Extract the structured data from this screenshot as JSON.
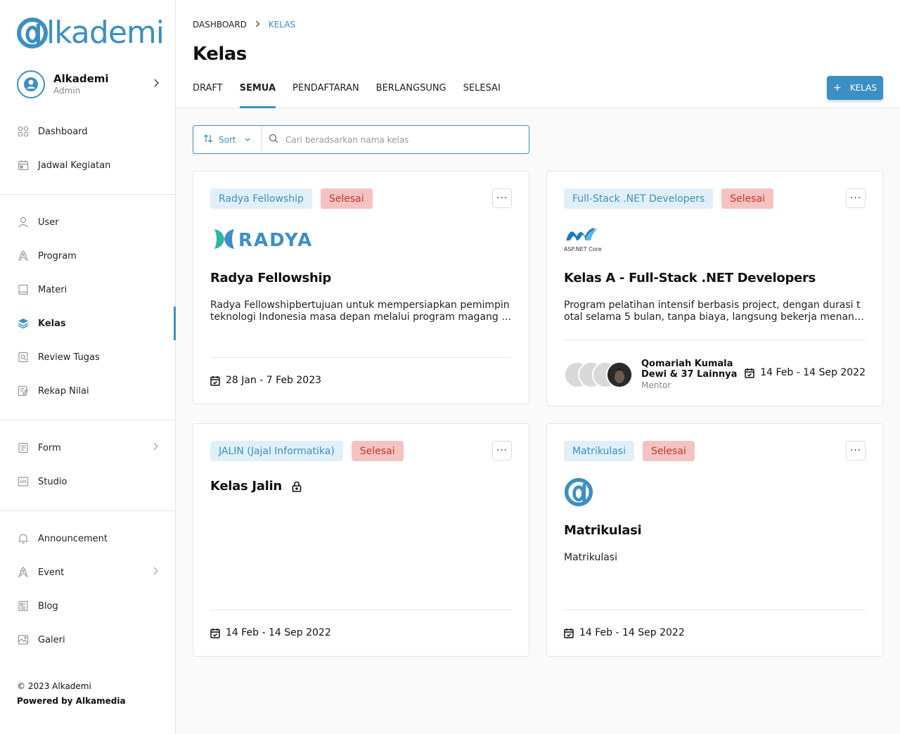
{
  "app": {
    "logo_text": "lkademi"
  },
  "profile": {
    "name": "Alkademi",
    "role": "Admin"
  },
  "nav": {
    "group1": [
      {
        "label": "Dashboard",
        "icon": "grid-icon"
      },
      {
        "label": "Jadwal Kegiatan",
        "icon": "calendar-icon"
      }
    ],
    "group2": [
      {
        "label": "User",
        "icon": "user-icon"
      },
      {
        "label": "Program",
        "icon": "rocket-icon"
      },
      {
        "label": "Materi",
        "icon": "book-icon"
      },
      {
        "label": "Kelas",
        "icon": "layers-icon",
        "active": true
      },
      {
        "label": "Review Tugas",
        "icon": "review-icon"
      },
      {
        "label": "Rekap Nilai",
        "icon": "edit-icon"
      }
    ],
    "group3": [
      {
        "label": "Form",
        "icon": "form-icon",
        "has_chevron": true
      },
      {
        "label": "Studio",
        "icon": "code-icon"
      }
    ],
    "group4": [
      {
        "label": "Announcement",
        "icon": "bell-icon"
      },
      {
        "label": "Event",
        "icon": "rocket-icon",
        "has_chevron": true
      },
      {
        "label": "Blog",
        "icon": "blog-icon"
      },
      {
        "label": "Galeri",
        "icon": "image-icon"
      }
    ]
  },
  "footer": {
    "copyright": "© 2023 Alkademi",
    "powered": "Powered by Alkamedia"
  },
  "breadcrumb": {
    "home": "DASHBOARD",
    "current": "KELAS"
  },
  "page_title": "Kelas",
  "tabs": [
    {
      "label": "DRAFT"
    },
    {
      "label": "SEMUA",
      "active": true
    },
    {
      "label": "PENDAFTARAN"
    },
    {
      "label": "BERLANGSUNG"
    },
    {
      "label": "SELESAI"
    }
  ],
  "add_button": {
    "label": "KELAS"
  },
  "toolbar": {
    "sort_label": "Sort",
    "search_placeholder": "Cari beradsarkan nama kelas"
  },
  "cards": [
    {
      "program": "Radya Fellowship",
      "status": "Selesai",
      "logo": "RADYA",
      "title": "Radya Fellowship",
      "description": "Radya Fellowshipbertujuan untuk mempersiapkan pemimpin teknologi Indonesia masa depan melalui program magang bersama Radya Labs.",
      "date": "28 Jan - 7 Feb 2023"
    },
    {
      "program": "Full-Stack .NET Developers",
      "status": "Selesai",
      "logo": "ASP.NET Core",
      "title": "Kelas A - Full-Stack .NET Developers",
      "description": "Program pelatihan intensif berbasis project, dengan durasi total selama 5 bulan, tanpa biaya, langsung bekerja menangani proyek nyata.",
      "mentor_names": "Qomariah Kumala Dewi & 37 Lainnya",
      "mentor_role": "Mentor",
      "date": "14 Feb - 14 Sep 2022"
    },
    {
      "program": "JALIN (Jajal Informatika)",
      "status": "Selesai",
      "title": "Kelas Jalin",
      "date": "14 Feb - 14 Sep 2022"
    },
    {
      "program": "Matrikulasi",
      "status": "Selesai",
      "title": "Matrikulasi",
      "description": "Matrikulasi",
      "date": "14 Feb - 14 Sep 2022"
    }
  ],
  "colors": {
    "accent": "#3b8fc4",
    "status_bg": "#f5c2c2",
    "status_text": "#c0392b",
    "tag_bg": "#e1f0f8"
  }
}
